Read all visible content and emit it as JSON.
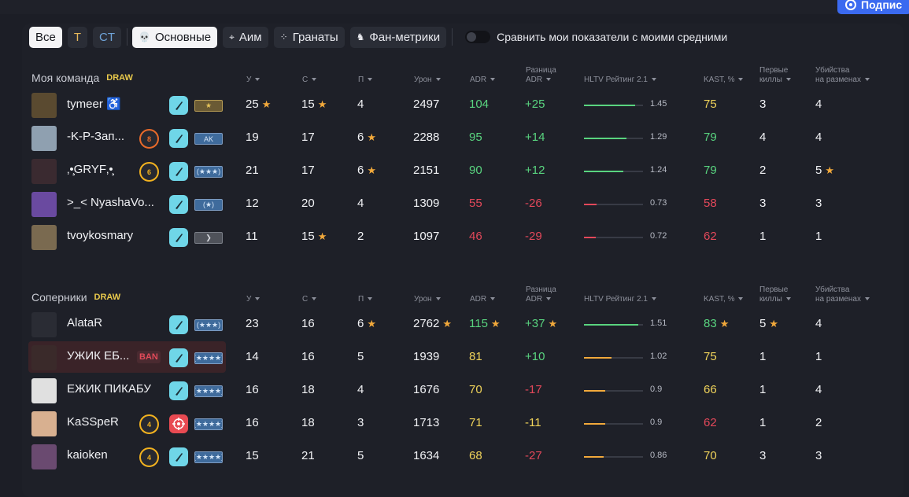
{
  "header": {
    "subscribe_label": "Подпис"
  },
  "filters": {
    "all": "Все",
    "t": "T",
    "ct": "CT",
    "tabs": [
      {
        "label": "Основные",
        "icon": "skull-icon",
        "active": true
      },
      {
        "label": "Аим",
        "icon": "crosshair-icon",
        "active": false
      },
      {
        "label": "Гранаты",
        "icon": "grenade-icon",
        "active": false
      },
      {
        "label": "Фан-метрики",
        "icon": "fan-icon",
        "active": false
      }
    ],
    "compare_label": "Сравнить мои показатели с моими средними"
  },
  "columns": {
    "k": "У",
    "d": "С",
    "a": "П",
    "dmg": "Урон",
    "adr": "ADR",
    "adr_diff_1": "Разница",
    "adr_diff_2": "ADR",
    "hltv": "HLTV Рейтинг 2.1",
    "kast": "KAST, %",
    "fk_1": "Первые",
    "fk_2": "киллы",
    "trade_1": "Убийства",
    "trade_2": "на разменах"
  },
  "teams": [
    {
      "title": "Моя команда",
      "result": "DRAW",
      "players": [
        {
          "name": "tymeer ♿",
          "level": "",
          "rank": "★",
          "rank_style": "gold",
          "k": "25",
          "k_star": true,
          "d": "15",
          "d_star": true,
          "a": "4",
          "a_star": false,
          "dmg": "2497",
          "dmg_star": false,
          "adr": "104",
          "adr_star": false,
          "adr_color": "green",
          "diff": "+25",
          "diff_star": false,
          "diff_color": "green",
          "hltv": 1.45,
          "hltv_text": "1.45",
          "bar_color": "g",
          "kast": "75",
          "kast_star": false,
          "kast_color": "yellow-t",
          "fk": "3",
          "fk_star": false,
          "trade": "4",
          "trade_star": false
        },
        {
          "name": "-K-P-Зап...",
          "level": "8",
          "level_color": "orange",
          "rank": "AK",
          "rank_style": "blue",
          "k": "19",
          "k_star": false,
          "d": "17",
          "d_star": false,
          "a": "6",
          "a_star": true,
          "dmg": "2288",
          "dmg_star": false,
          "adr": "95",
          "adr_star": false,
          "adr_color": "green",
          "diff": "+14",
          "diff_star": false,
          "diff_color": "green",
          "hltv": 1.29,
          "hltv_text": "1.29",
          "bar_color": "g",
          "kast": "79",
          "kast_star": false,
          "kast_color": "green",
          "fk": "4",
          "fk_star": false,
          "trade": "4",
          "trade_star": false
        },
        {
          "name": "‚•̧GRYF‚•̧",
          "level": "6",
          "level_color": "yellow",
          "rank": "(★★★)",
          "rank_style": "blue",
          "k": "21",
          "k_star": false,
          "d": "17",
          "d_star": false,
          "a": "6",
          "a_star": true,
          "dmg": "2151",
          "dmg_star": false,
          "adr": "90",
          "adr_star": false,
          "adr_color": "green",
          "diff": "+12",
          "diff_star": false,
          "diff_color": "green",
          "hltv": 1.24,
          "hltv_text": "1.24",
          "bar_color": "g",
          "kast": "79",
          "kast_star": false,
          "kast_color": "green",
          "fk": "2",
          "fk_star": false,
          "trade": "5",
          "trade_star": true
        },
        {
          "name": ">_< NyashaVo...",
          "level": "",
          "rank": "(★)",
          "rank_style": "blue",
          "k": "12",
          "k_star": false,
          "d": "20",
          "d_star": false,
          "a": "4",
          "a_star": false,
          "dmg": "1309",
          "dmg_star": false,
          "adr": "55",
          "adr_star": false,
          "adr_color": "red-t",
          "diff": "-26",
          "diff_star": false,
          "diff_color": "red-t",
          "hltv": 0.73,
          "hltv_text": "0.73",
          "bar_color": "r",
          "kast": "58",
          "kast_star": false,
          "kast_color": "red-t",
          "fk": "3",
          "fk_star": false,
          "trade": "3",
          "trade_star": false
        },
        {
          "name": "tvoykosmary",
          "level": "",
          "rank": "❯",
          "rank_style": "grey",
          "k": "11",
          "k_star": false,
          "d": "15",
          "d_star": true,
          "a": "2",
          "a_star": false,
          "dmg": "1097",
          "dmg_star": false,
          "adr": "46",
          "adr_star": false,
          "adr_color": "red-t",
          "diff": "-29",
          "diff_star": false,
          "diff_color": "red-t",
          "hltv": 0.72,
          "hltv_text": "0.72",
          "bar_color": "r",
          "kast": "62",
          "kast_star": false,
          "kast_color": "red-t",
          "fk": "1",
          "fk_star": false,
          "trade": "1",
          "trade_star": false
        }
      ]
    },
    {
      "title": "Соперники",
      "result": "DRAW",
      "players": [
        {
          "name": "AlataR",
          "level": "",
          "rank": "(★★★)",
          "rank_style": "blue",
          "k": "23",
          "k_star": false,
          "d": "16",
          "d_star": false,
          "a": "6",
          "a_star": true,
          "dmg": "2762",
          "dmg_star": true,
          "adr": "115",
          "adr_star": true,
          "adr_color": "green",
          "diff": "+37",
          "diff_star": true,
          "diff_color": "green",
          "hltv": 1.51,
          "hltv_text": "1.51",
          "bar_color": "g",
          "kast": "83",
          "kast_star": true,
          "kast_color": "green",
          "fk": "5",
          "fk_star": true,
          "trade": "4",
          "trade_star": false
        },
        {
          "name": "УЖИК ЕБ...",
          "ban": "BAN",
          "level": "",
          "rank": "(★★★★)",
          "rank_style": "blue",
          "k": "14",
          "k_star": false,
          "d": "16",
          "d_star": false,
          "a": "5",
          "a_star": false,
          "dmg": "1939",
          "dmg_star": false,
          "adr": "81",
          "adr_star": false,
          "adr_color": "yellow-t",
          "diff": "+10",
          "diff_star": false,
          "diff_color": "green",
          "hltv": 1.02,
          "hltv_text": "1.02",
          "bar_color": "o",
          "kast": "75",
          "kast_star": false,
          "kast_color": "yellow-t",
          "fk": "1",
          "fk_star": false,
          "trade": "1",
          "trade_star": false
        },
        {
          "name": "ЕЖИК ПИКАБУ",
          "level": "",
          "rank": "(★★★★)",
          "rank_style": "blue",
          "k": "16",
          "k_star": false,
          "d": "18",
          "d_star": false,
          "a": "4",
          "a_star": false,
          "dmg": "1676",
          "dmg_star": false,
          "adr": "70",
          "adr_star": false,
          "adr_color": "yellow-t",
          "diff": "-17",
          "diff_star": false,
          "diff_color": "red-t",
          "hltv": 0.9,
          "hltv_text": "0.9",
          "bar_color": "o",
          "kast": "66",
          "kast_star": false,
          "kast_color": "yellow-t",
          "fk": "1",
          "fk_star": false,
          "trade": "4",
          "trade_star": false
        },
        {
          "name": "KaSSpeR",
          "level": "4",
          "level_color": "yellow",
          "knife_red": true,
          "rank": "(★★★★)",
          "rank_style": "blue",
          "k": "16",
          "k_star": false,
          "d": "18",
          "d_star": false,
          "a": "3",
          "a_star": false,
          "dmg": "1713",
          "dmg_star": false,
          "adr": "71",
          "adr_star": false,
          "adr_color": "yellow-t",
          "diff": "-11",
          "diff_star": false,
          "diff_color": "yellow-t",
          "hltv": 0.9,
          "hltv_text": "0.9",
          "bar_color": "o",
          "kast": "62",
          "kast_star": false,
          "kast_color": "red-t",
          "fk": "1",
          "fk_star": false,
          "trade": "2",
          "trade_star": false
        },
        {
          "name": "kaioken",
          "level": "4",
          "level_color": "yellow",
          "rank": "(★★★★)",
          "rank_style": "blue",
          "k": "15",
          "k_star": false,
          "d": "21",
          "d_star": false,
          "a": "5",
          "a_star": false,
          "dmg": "1634",
          "dmg_star": false,
          "adr": "68",
          "adr_star": false,
          "adr_color": "yellow-t",
          "diff": "-27",
          "diff_star": false,
          "diff_color": "red-t",
          "hltv": 0.86,
          "hltv_text": "0.86",
          "bar_color": "o",
          "kast": "70",
          "kast_star": false,
          "kast_color": "yellow-t",
          "fk": "3",
          "fk_star": false,
          "trade": "3",
          "trade_star": false
        }
      ]
    }
  ]
}
